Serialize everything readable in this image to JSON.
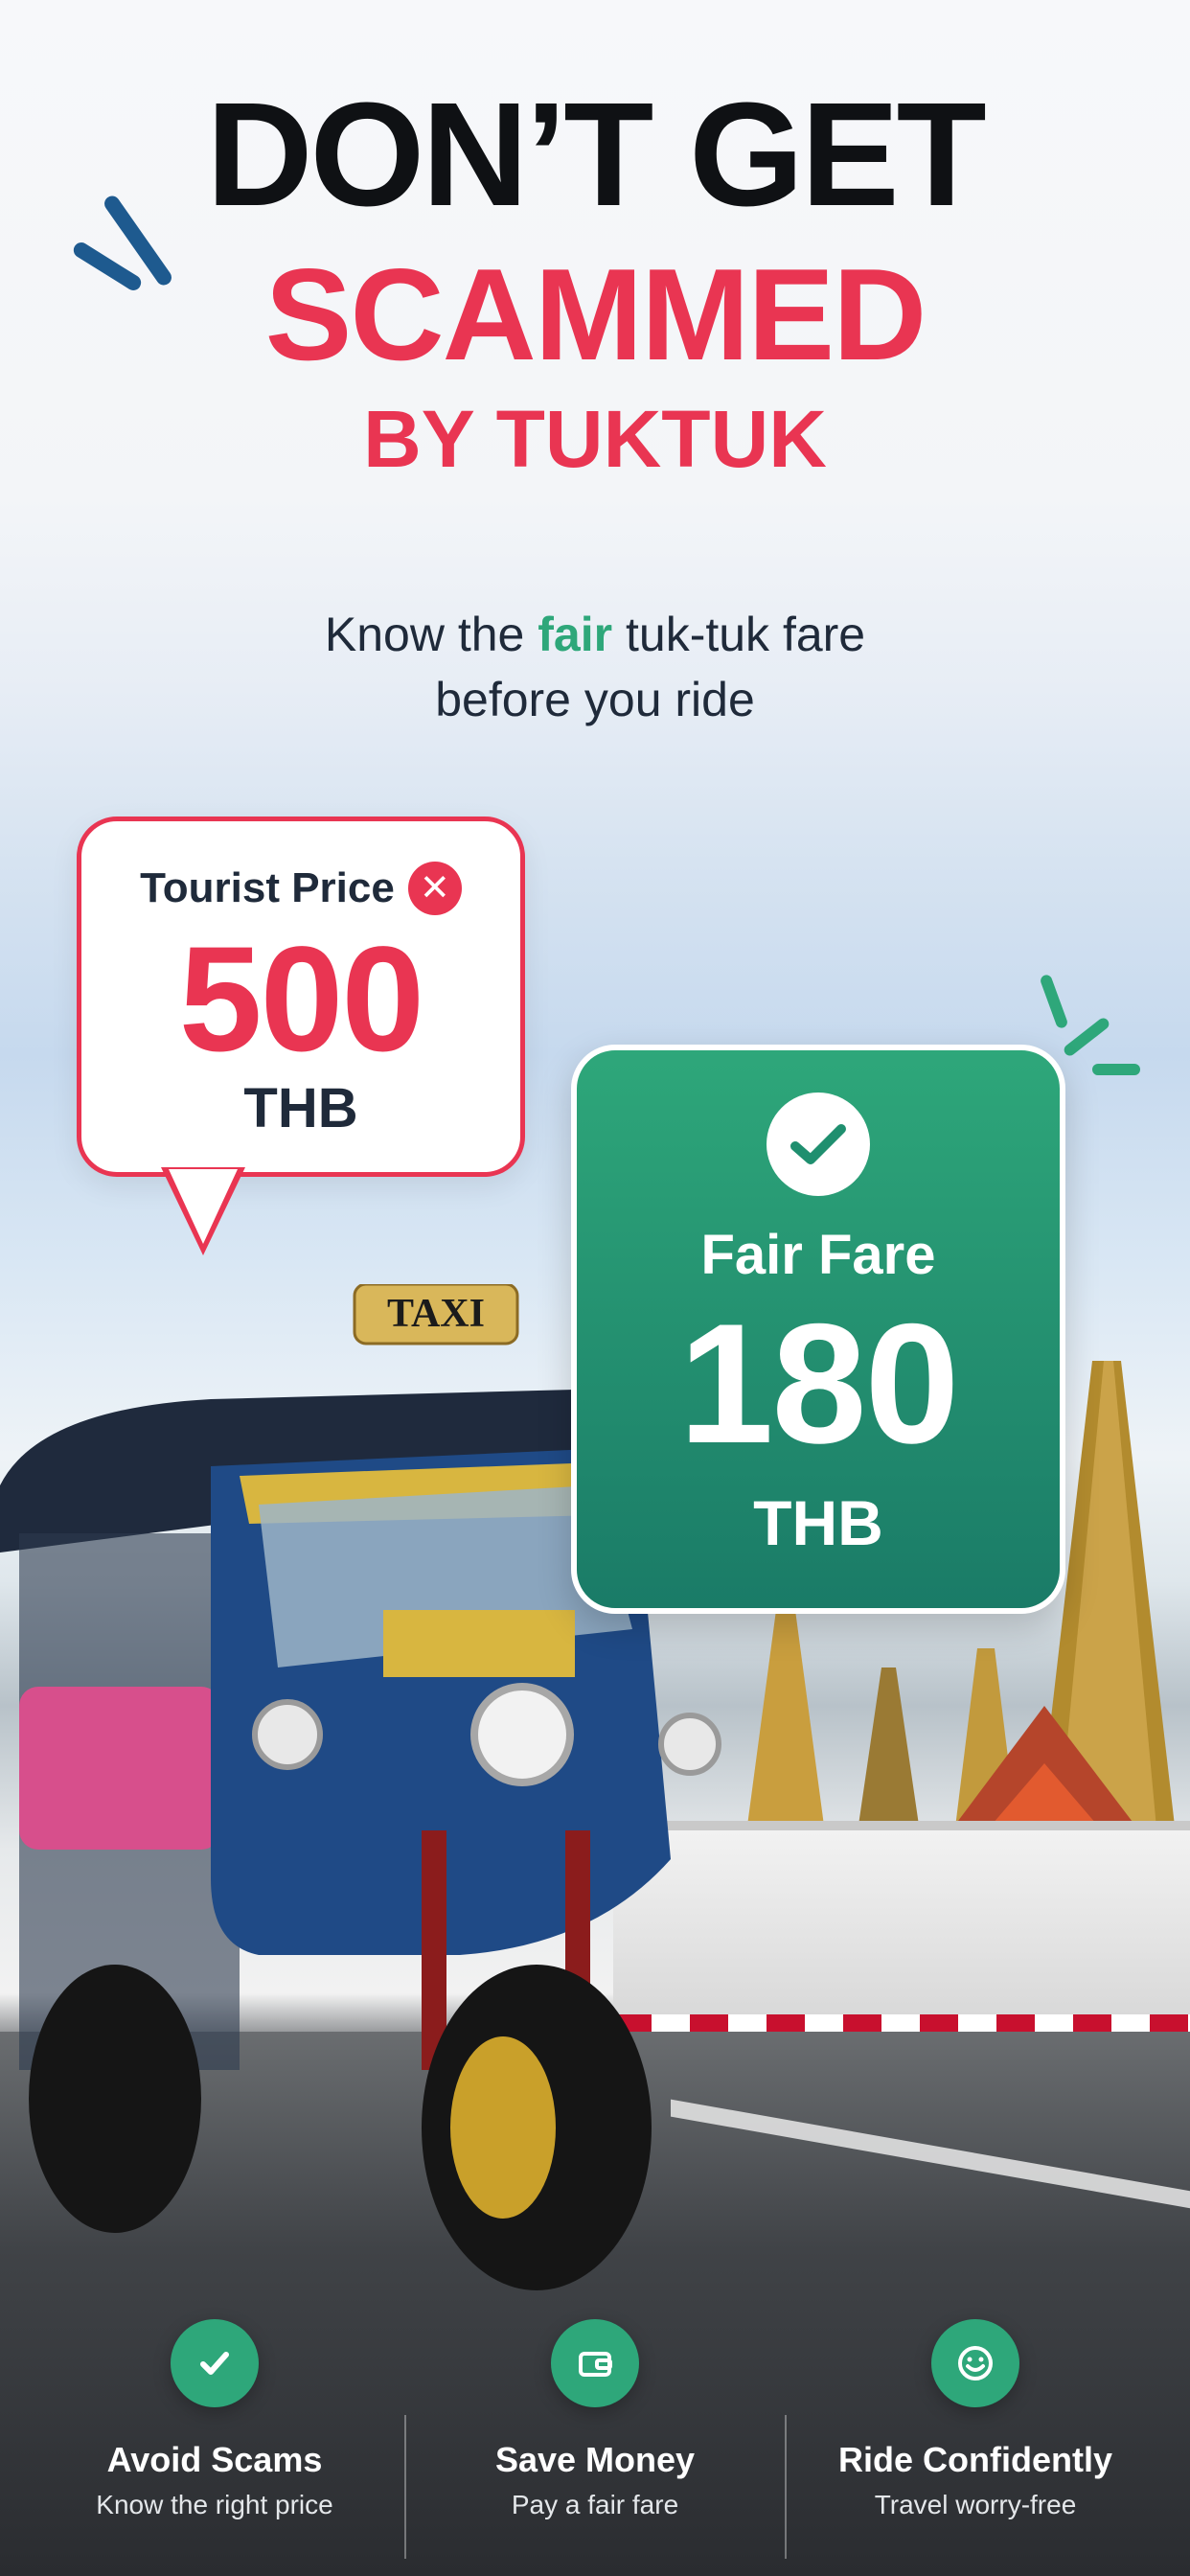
{
  "headline": {
    "line1": "DON’T GET",
    "line2": "SCAMMED",
    "line3": "BY TUKTUK"
  },
  "subtitle": {
    "before": "Know the",
    "highlight": "fair",
    "after": "tuk-tuk fare",
    "line2": "before you ride"
  },
  "tourist_bubble": {
    "label": "Tourist Price",
    "price": "500",
    "currency": "THB"
  },
  "fair_card": {
    "label": "Fair Fare",
    "price": "180",
    "currency": "THB"
  },
  "tuktuk": {
    "sign": "TAXI"
  },
  "features": [
    {
      "title": "Avoid Scams",
      "desc": "Know the right price",
      "icon": "check-icon"
    },
    {
      "title": "Save Money",
      "desc": "Pay a fair fare",
      "icon": "wallet-icon"
    },
    {
      "title": "Ride Confidently",
      "desc": "Travel worry-free",
      "icon": "smile-icon"
    }
  ],
  "colors": {
    "accent_red": "#e93552",
    "accent_green": "#2ea77a",
    "dark_text": "#0f1114",
    "blue_sparkle": "#1e5a8f"
  }
}
